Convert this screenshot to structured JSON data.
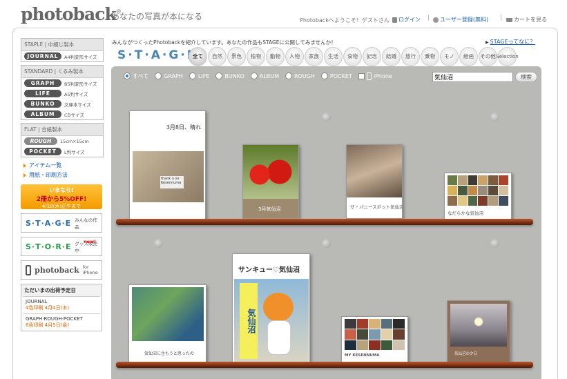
{
  "header": {
    "logo": "photoback",
    "logo_mark": "®",
    "tagline": "あなたの写真が本になる",
    "welcome": "Photobackへようこそ！ゲストさん",
    "login": "ログイン",
    "register": "ユーザー登録(無料)",
    "cart": "カートを見る"
  },
  "sidebar": {
    "staple_head": "STAPLE | 中綴じ製本",
    "staple_items": [
      {
        "label": "JOURNAL",
        "desc": "A4判変形サイズ"
      }
    ],
    "standard_head": "STANDARD | くるみ製本",
    "standard_items": [
      {
        "label": "GRAPH",
        "desc": "B5判変形サイズ"
      },
      {
        "label": "LIFE",
        "desc": "A5判サイズ"
      },
      {
        "label": "BUNKO",
        "desc": "文庫本サイズ"
      },
      {
        "label": "ALBUM",
        "desc": "CDサイズ"
      }
    ],
    "flat_head": "FLAT | 合紙製本",
    "flat_items": [
      {
        "label": "ROUGH",
        "desc": "15cm×15cm"
      },
      {
        "label": "POCKET",
        "desc": "L判サイズ"
      }
    ],
    "links": [
      "アイテム一覧",
      "用紙・印刷方法"
    ],
    "promo": {
      "line1": "いまなら!",
      "line2": "2冊から5%OFF!",
      "line3": "4/18(木)正午まで"
    },
    "stage_banner": {
      "big": "S·T·A·G·E",
      "small": "みんなの作品"
    },
    "store_banner": {
      "big": "S·T·O·R·E",
      "small": "グッズ販売中",
      "tag": "new!"
    },
    "iphone_banner": {
      "big": "photoback",
      "small": "for iPhone"
    },
    "schedule": {
      "head": "ただいまの出荷予定日",
      "items": [
        {
          "title": "JOURNAL",
          "date": "4色印刷 4月4日(木)"
        },
        {
          "title": "GRAPH·ROUGH·POCKET",
          "date": "6色印刷 4月5日(金)"
        }
      ]
    }
  },
  "main": {
    "intro": "みんながつくったPhotobackを紹介しています。あなたの作品もSTAGEに公開してみませんか！",
    "stage_link": "STAGEってなに？",
    "stage_logo": "S·T·A·G·E",
    "categories": [
      "全て",
      "自然",
      "景色",
      "植物",
      "動物",
      "人物",
      "家族",
      "生活",
      "食物",
      "記念",
      "結婚",
      "旅行",
      "乗物",
      "モノ",
      "絵画",
      "その他",
      "Selection"
    ],
    "filters": [
      "すべて",
      "GRAPH",
      "LIFE",
      "BUNKO",
      "ALBUM",
      "ROUGH",
      "POCKET"
    ],
    "iphone_filter": "iPhone",
    "search_value": "気仙沼",
    "search_button": "検索"
  },
  "books": [
    {
      "title": "3月8日、晴れ",
      "photo_text": "thank u xx Kesennuma"
    },
    {
      "title": "3月気仙沼"
    },
    {
      "title": "ザ・パニースポット気仙沼"
    },
    {
      "title": "なだらかな気仙沼"
    },
    {
      "title": "気仙沼に住もうと思ったの"
    },
    {
      "title": "サンキュー♡気仙沼",
      "sign": "気仙沼"
    },
    {
      "title": "MY KESENNUMA"
    },
    {
      "title": "気仙沼の夕日"
    }
  ],
  "colors": {
    "accent": "#1a5fb4",
    "stage_blue": "#4b86ae",
    "wall": "#b9b9b6",
    "shelf": "#7a2f12",
    "promo": "#f39a00"
  }
}
